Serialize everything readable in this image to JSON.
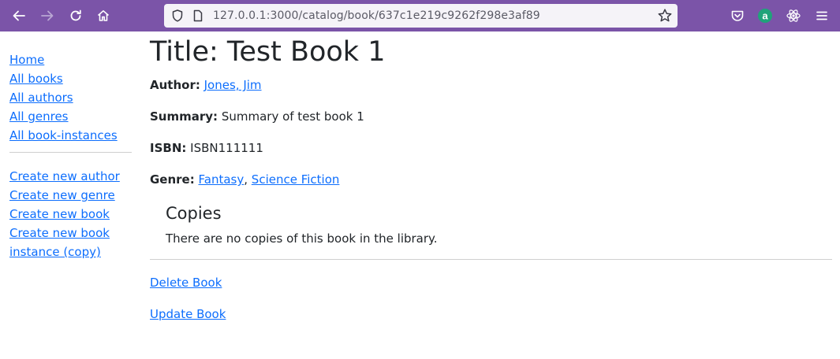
{
  "browser": {
    "url": "127.0.0.1:3000/catalog/book/637c1e219c9262f298e3af89",
    "icons": [
      "back-arrow-icon",
      "forward-arrow-icon",
      "reload-icon",
      "home-icon",
      "shield-icon",
      "page-icon",
      "bookmark-star-icon",
      "pocket-icon",
      "extension-avatar-icon",
      "react-devtools-icon",
      "menu-icon"
    ],
    "extension_letter": "a",
    "colors": {
      "toolbar": "#7b54a8",
      "urlbar": "#f5f3f8",
      "link": "#0d6efd"
    }
  },
  "sidebar": {
    "links": [
      "Home",
      "All books",
      "All authors",
      "All genres",
      "All book-instances"
    ],
    "create_links": [
      "Create new author",
      "Create new genre",
      "Create new book",
      "Create new book",
      "instance (copy)"
    ]
  },
  "book": {
    "title": "Title: Test Book 1",
    "author_label": "Author:",
    "author": "Jones, Jim",
    "summary_label": "Summary:",
    "summary": "Summary of test book 1",
    "isbn_label": "ISBN:",
    "isbn": "ISBN111111",
    "genre_label": "Genre:",
    "genres": [
      "Fantasy",
      "Science Fiction"
    ],
    "genre_separator": ",",
    "copies_heading": "Copies",
    "copies_text": "There are no copies of this book in the library.",
    "delete_label": "Delete Book",
    "update_label": "Update Book"
  }
}
